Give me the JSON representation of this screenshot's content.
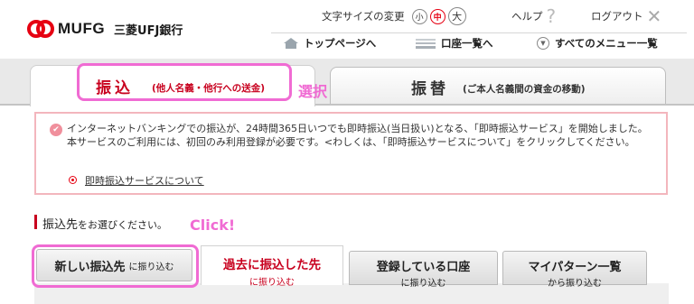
{
  "header": {
    "logo_text": "MUFG",
    "bank_name": "三菱UFJ銀行",
    "font_size_label": "文字サイズの変更",
    "font_sizes": [
      "小",
      "中",
      "大"
    ],
    "help": "ヘルプ",
    "logout": "ログアウト"
  },
  "nav": {
    "top_page": "トップページへ",
    "account_list": "口座一覧へ",
    "all_menu": "すべてのメニュー一覧"
  },
  "tabs": {
    "transfer_label": "振込",
    "transfer_sub": "(他人名義・他行への送金)",
    "move_label": "振替",
    "move_sub": "(ご本人名義間の資金の移動)"
  },
  "annotations": {
    "select": "選択",
    "click": "Click!"
  },
  "notice": {
    "text": "インターネットバンキングでの振込が、24時間365日いつでも即時振込(当日扱い)となる、「即時振込サービス」を開始しました。本サービスのご利用には、初回のみ利用登録が必要です。<わしくは、「即時振込サービスについて」をクリックしてください。",
    "link": "即時振込サービスについて"
  },
  "section": {
    "title": "振込先",
    "title_small": "をお選びください。"
  },
  "subtabs": [
    {
      "main": "新しい振込先",
      "sub": "に振り込む"
    },
    {
      "main": "過去に振込した先",
      "sub": "に振り込む"
    },
    {
      "main": "登録している口座",
      "sub": "に振り込む"
    },
    {
      "main": "マイパターン一覧",
      "sub": "から振り込む"
    }
  ],
  "colors": {
    "brand_red": "#e60012",
    "highlight": "#f06bd3",
    "notice_border": "#f3b6bd"
  }
}
